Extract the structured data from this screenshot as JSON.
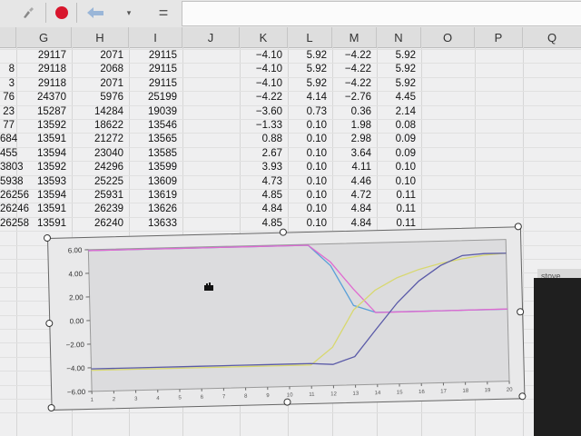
{
  "columns": [
    "G",
    "H",
    "I",
    "J",
    "K",
    "L",
    "M",
    "N",
    "O",
    "P",
    "Q"
  ],
  "rows": [
    [
      "29117",
      "2071",
      "29115",
      "",
      "−4.10",
      "5.92",
      "−4.22",
      "5.92"
    ],
    [
      "29118",
      "2068",
      "29115",
      "",
      "−4.10",
      "5.92",
      "−4.22",
      "5.92"
    ],
    [
      "29118",
      "2071",
      "29115",
      "",
      "−4.10",
      "5.92",
      "−4.22",
      "5.92"
    ],
    [
      "24370",
      "5976",
      "25199",
      "",
      "−4.22",
      "4.14",
      "−2.76",
      "4.45"
    ],
    [
      "15287",
      "14284",
      "19039",
      "",
      "−3.60",
      "0.73",
      "0.36",
      "2.14"
    ],
    [
      "13592",
      "18622",
      "13546",
      "",
      "−1.33",
      "0.10",
      "1.98",
      "0.08"
    ],
    [
      "13591",
      "21272",
      "13565",
      "",
      "0.88",
      "0.10",
      "2.98",
      "0.09"
    ],
    [
      "13594",
      "23040",
      "13585",
      "",
      "2.67",
      "0.10",
      "3.64",
      "0.09"
    ],
    [
      "13592",
      "24296",
      "13599",
      "",
      "3.93",
      "0.10",
      "4.11",
      "0.10"
    ],
    [
      "13593",
      "25225",
      "13609",
      "",
      "4.73",
      "0.10",
      "4.46",
      "0.10"
    ],
    [
      "13594",
      "25931",
      "13619",
      "",
      "4.85",
      "0.10",
      "4.72",
      "0.11"
    ],
    [
      "13591",
      "26239",
      "13626",
      "",
      "4.84",
      "0.10",
      "4.84",
      "0.11"
    ],
    [
      "13591",
      "26240",
      "13633",
      "",
      "4.85",
      "0.10",
      "4.84",
      "0.11"
    ]
  ],
  "left_partial_cells": [
    "8",
    "3",
    "76",
    "23",
    "77",
    "684",
    "455",
    "3803",
    "5938",
    "26256",
    "26246",
    "26258"
  ],
  "chart_data": {
    "type": "line",
    "title": "",
    "xlabel": "",
    "ylabel": "",
    "x": [
      1,
      2,
      3,
      4,
      5,
      6,
      7,
      8,
      9,
      10,
      11,
      12,
      13,
      14,
      15,
      16,
      17,
      18,
      19,
      20
    ],
    "ylim": [
      -6,
      6
    ],
    "yticks": [
      "6.00",
      "4.00",
      "2.00",
      "0.00",
      "−2.00",
      "−4.00",
      "−6.00"
    ],
    "series": [
      {
        "color": "#5aa0d8",
        "values": [
          5.92,
          5.92,
          5.92,
          5.92,
          5.92,
          5.92,
          5.92,
          5.92,
          5.92,
          5.92,
          5.92,
          4.14,
          0.73,
          0.1,
          0.1,
          0.1,
          0.1,
          0.1,
          0.1,
          0.1
        ]
      },
      {
        "color": "#e06ad0",
        "values": [
          5.92,
          5.92,
          5.92,
          5.92,
          5.92,
          5.92,
          5.92,
          5.92,
          5.92,
          5.92,
          5.92,
          4.45,
          2.14,
          0.08,
          0.09,
          0.09,
          0.1,
          0.1,
          0.11,
          0.11
        ]
      },
      {
        "color": "#d8d870",
        "values": [
          -4.22,
          -4.22,
          -4.22,
          -4.22,
          -4.22,
          -4.22,
          -4.22,
          -4.22,
          -4.22,
          -4.22,
          -4.22,
          -2.76,
          0.36,
          1.98,
          2.98,
          3.64,
          4.11,
          4.46,
          4.72,
          4.84
        ]
      },
      {
        "color": "#5a5aa8",
        "values": [
          -4.1,
          -4.1,
          -4.1,
          -4.1,
          -4.1,
          -4.1,
          -4.1,
          -4.1,
          -4.1,
          -4.1,
          -4.1,
          -4.22,
          -3.6,
          -1.33,
          0.88,
          2.67,
          3.93,
          4.73,
          4.85,
          4.84
        ]
      }
    ]
  },
  "right_strip_label": "stove"
}
